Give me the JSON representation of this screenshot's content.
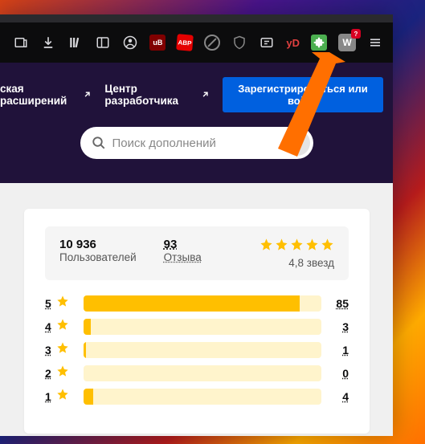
{
  "toolbar": {
    "ext_ublock": "uB",
    "ext_abp": "ABP",
    "ext_yd_y": "y",
    "ext_yd_d": "D",
    "ext_w": "W",
    "ext_w_badge": "?"
  },
  "nav": {
    "workshop": "ская расширений",
    "devcenter": "Центр разработчика",
    "login": "Зарегистрироваться или войти"
  },
  "search": {
    "placeholder": "Поиск дополнений"
  },
  "stats": {
    "users_count": "10 936",
    "users_label": "Пользователей",
    "reviews_count": "93",
    "reviews_label": "Отзыва",
    "avg_label": "4,8 звезд"
  },
  "dist": [
    {
      "rank": "5",
      "count": "85",
      "pct": 91
    },
    {
      "rank": "4",
      "count": "3",
      "pct": 3
    },
    {
      "rank": "3",
      "count": "1",
      "pct": 1
    },
    {
      "rank": "2",
      "count": "0",
      "pct": 0
    },
    {
      "rank": "1",
      "count": "4",
      "pct": 4
    }
  ]
}
